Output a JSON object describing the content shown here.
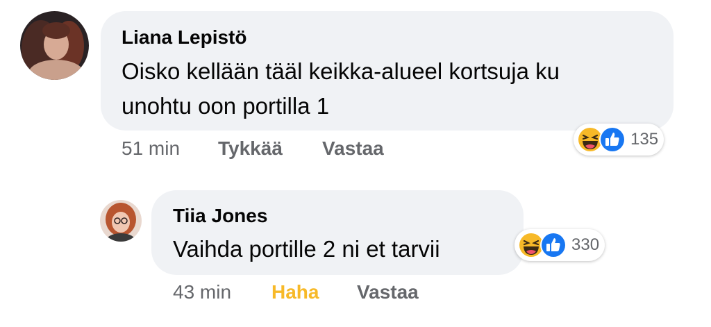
{
  "comments": [
    {
      "author": "Liana Lepistö",
      "text_lines": [
        "Oisko kellään tääl keikka-alueel kortsuja ku",
        "unohtu oon portilla 1"
      ],
      "time": "51 min",
      "like_label": "Tykkää",
      "reply_label": "Vastaa",
      "reaction_count": "135",
      "reaction_icons": [
        "haha-icon",
        "like-icon"
      ]
    },
    {
      "author": "Tiia Jones",
      "text_lines": [
        "Vaihda portille 2 ni et tarvii"
      ],
      "time": "43 min",
      "like_label": "Haha",
      "reply_label": "Vastaa",
      "reaction_count": "330",
      "reaction_icons": [
        "haha-icon",
        "like-icon"
      ]
    }
  ],
  "colors": {
    "bubble": "#f0f2f5",
    "meta_text": "#65676b",
    "haha_active": "#f7b928",
    "like_blue": "#1877f2"
  }
}
